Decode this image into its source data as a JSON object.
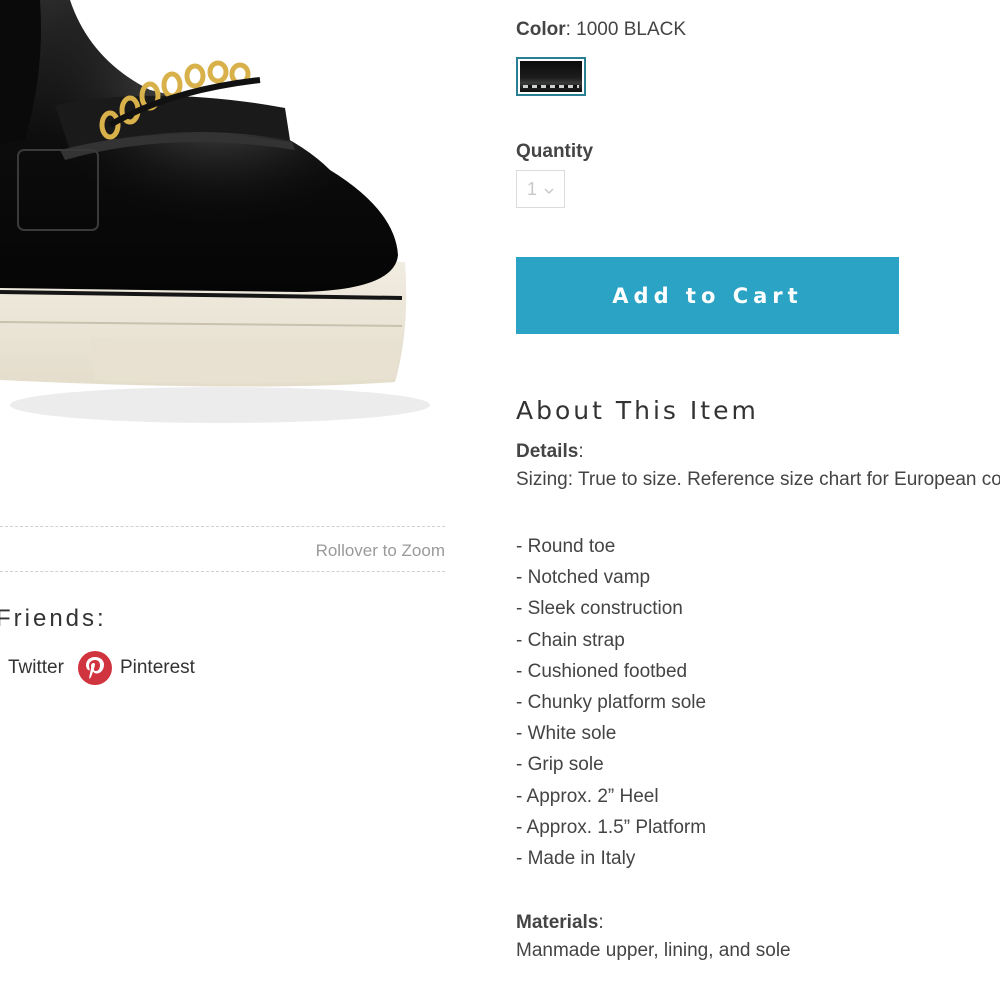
{
  "image": {
    "alt": ""
  },
  "zoom": {
    "hint": "Rollover to Zoom"
  },
  "share": {
    "heading": "Friends:",
    "links": [
      {
        "label": "Twitter"
      },
      {
        "label": "Pinterest",
        "icon": "pinterest-icon",
        "color": "#d0343f"
      }
    ]
  },
  "color": {
    "label": "Color",
    "value": "1000 BLACK",
    "swatch_border": "#2a7f94"
  },
  "quantity": {
    "label": "Quantity",
    "value": "1",
    "icon": "chevron-down-icon"
  },
  "cart": {
    "label": "Add to Cart",
    "color": "#2aa3c4"
  },
  "about": {
    "heading": "About This Item",
    "details_label": "Details",
    "sizing": "Sizing: True to size. Reference size chart for European conve",
    "features": [
      "- Round toe",
      "- Notched vamp",
      "- Sleek construction",
      "- Chain strap",
      "- Cushioned footbed",
      "- Chunky platform sole",
      "- White sole",
      "- Grip sole",
      "- Approx. 2” Heel",
      "- Approx. 1.5” Platform",
      "- Made in Italy"
    ],
    "materials_label": "Materials",
    "materials": "Manmade upper, lining, and sole"
  }
}
